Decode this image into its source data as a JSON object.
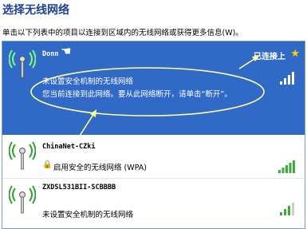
{
  "header": {
    "title": "选择无线网络",
    "instructions": "单击以下列表中的项目以连接到区域内的无线网络或获得更多信息(W)。"
  },
  "networks": [
    {
      "name": "Donn",
      "status": "已连接上",
      "security_text": "未设置安全机制的无线网络",
      "connected_text": "您当前连接到此网络。要从此网络断开，请单击“断开”。",
      "signal_bars": 4,
      "bar_color": "#ffffff"
    },
    {
      "name": "ChinaNet-CZki",
      "security_text": "启用安全的无线网络 (WPA)",
      "signal_bars": 5,
      "bar_color": "#3bab3b"
    },
    {
      "name": "ZXDSL531BII-SCBBBB",
      "security_text": "未设置安全机制的无线网络",
      "signal_bars": 4,
      "bar_color": "#3bab3b"
    }
  ],
  "colors": {
    "selection": "#3169c6",
    "callout": "#ffff99",
    "star": "#ffd200"
  },
  "icons": [
    "wireless-antenna-icon",
    "favorite-star-icon",
    "lock-icon",
    "signal-strength-icon",
    "hand-cursor-icon"
  ]
}
